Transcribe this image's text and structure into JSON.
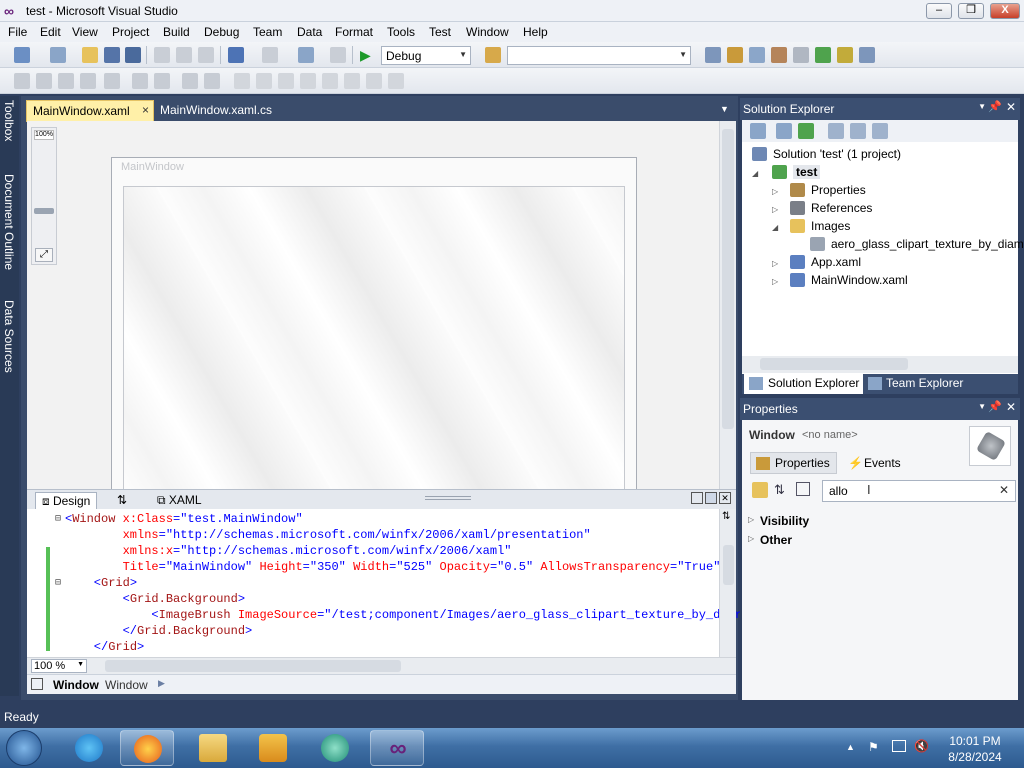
{
  "window": {
    "title": "test - Microsoft Visual Studio",
    "min": "–",
    "restore": "❒",
    "close": "X"
  },
  "menu": [
    "File",
    "Edit",
    "View",
    "Project",
    "Build",
    "Debug",
    "Team",
    "Data",
    "Format",
    "Tools",
    "Test",
    "Window",
    "Help"
  ],
  "toolbar": {
    "config": "Debug",
    "platform": ""
  },
  "sidebar_tabs": [
    "Toolbox",
    "Document Outline",
    "Data Sources"
  ],
  "doc_tabs": [
    {
      "label": "MainWindow.xaml",
      "close": "×"
    },
    {
      "label": "MainWindow.xaml.cs"
    }
  ],
  "designer": {
    "zoom_label": "100%",
    "window_title": "MainWindow"
  },
  "split_tabs": {
    "design": "Design",
    "swap": "⇅",
    "xaml": "XAML"
  },
  "code_lines": [
    [
      [
        "pun",
        "<"
      ],
      [
        "tag",
        "Window"
      ],
      [
        "attr",
        " x:Class"
      ],
      [
        "pun",
        "="
      ],
      [
        "val",
        "\"test.MainWindow\""
      ]
    ],
    [
      [
        "attr",
        "        xmlns"
      ],
      [
        "pun",
        "="
      ],
      [
        "val",
        "\"http://schemas.microsoft.com/winfx/2006/xaml/presentation\""
      ]
    ],
    [
      [
        "attr",
        "        xmlns:x"
      ],
      [
        "pun",
        "="
      ],
      [
        "val",
        "\"http://schemas.microsoft.com/winfx/2006/xaml\""
      ]
    ],
    [
      [
        "attr",
        "        Title"
      ],
      [
        "pun",
        "="
      ],
      [
        "val",
        "\"MainWindow\""
      ],
      [
        "attr",
        " Height"
      ],
      [
        "pun",
        "="
      ],
      [
        "val",
        "\"350\""
      ],
      [
        "attr",
        " Width"
      ],
      [
        "pun",
        "="
      ],
      [
        "val",
        "\"525\""
      ],
      [
        "attr",
        " Opacity"
      ],
      [
        "pun",
        "="
      ],
      [
        "val",
        "\"0.5\""
      ],
      [
        "attr",
        " AllowsTransparency"
      ],
      [
        "pun",
        "="
      ],
      [
        "val",
        "\"True\""
      ],
      [
        "pun",
        ">"
      ]
    ],
    [
      [
        "pun",
        "    <"
      ],
      [
        "tag",
        "Grid"
      ],
      [
        "pun",
        ">"
      ]
    ],
    [
      [
        "pun",
        "        <"
      ],
      [
        "tag",
        "Grid.Background"
      ],
      [
        "pun",
        ">"
      ]
    ],
    [
      [
        "pun",
        "            <"
      ],
      [
        "tag",
        "ImageBrush"
      ],
      [
        "attr",
        " ImageSource"
      ],
      [
        "pun",
        "="
      ],
      [
        "val",
        "\"/test;component/Images/aero_glass_clipart_texture_by_diar"
      ]
    ],
    [
      [
        "pun",
        "        </"
      ],
      [
        "tag",
        "Grid.Background"
      ],
      [
        "pun",
        ">"
      ]
    ],
    [
      [
        "pun",
        "    </"
      ],
      [
        "tag",
        "Grid"
      ],
      [
        "pun",
        ">"
      ]
    ]
  ],
  "code_zoom": "100 %",
  "breadcrumb": {
    "element": "Window",
    "type": "Window"
  },
  "solution_explorer": {
    "title": "Solution Explorer",
    "items": [
      {
        "label": "Solution 'test' (1 project)",
        "bold": false
      },
      {
        "label": "test",
        "bold": true
      },
      {
        "label": "Properties",
        "bold": false
      },
      {
        "label": "References",
        "bold": false
      },
      {
        "label": "Images",
        "bold": false
      },
      {
        "label": "aero_glass_clipart_texture_by_diamo",
        "bold": false
      },
      {
        "label": "App.xaml",
        "bold": false
      },
      {
        "label": "MainWindow.xaml",
        "bold": false
      }
    ],
    "bottom_tabs": [
      "Solution Explorer",
      "Team Explorer"
    ]
  },
  "properties": {
    "title": "Properties",
    "object_type": "Window",
    "object_name": "<no name>",
    "tabs": [
      "Properties",
      "Events"
    ],
    "search_value": "allo",
    "categories": [
      "Visibility",
      "Other"
    ]
  },
  "status": {
    "text": "Ready"
  },
  "clock": {
    "time": "10:01 PM",
    "date": "8/28/2024"
  }
}
